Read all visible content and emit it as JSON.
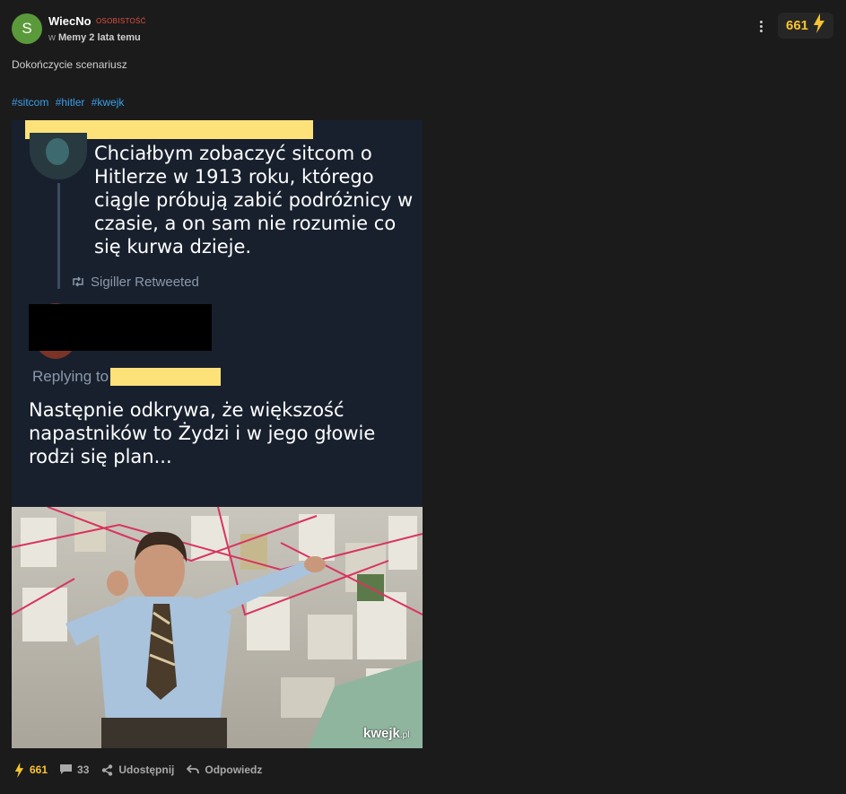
{
  "post": {
    "avatar_letter": "S",
    "username": "WiecNo",
    "badge": "OSOBISTOŚĆ",
    "meta_prefix": "w",
    "category": "Memy",
    "time": "2 lata temu",
    "score": "661",
    "description": "Dokończycie scenariusz",
    "tags": [
      "#sitcom",
      "#hitler",
      "#kwejk"
    ]
  },
  "meme": {
    "tweet1_text": "Chciałbym zobaczyć sitcom o Hitlerze w 1913 roku, którego ciągle próbują zabić podróżnicy w czasie, a on sam nie rozumie co się kurwa dzieje.",
    "retweet_text": "Sigiller Retweeted",
    "replying_text": "Replying to",
    "tweet2_text": "Następnie odkrywa, że większość napastników to Żydzi i w jego głowie rodzi się plan...",
    "watermark_main": "kwejk",
    "watermark_suffix": ".pl"
  },
  "actions": {
    "score": "661",
    "comments": "33",
    "share_label": "Udostępnij",
    "reply_label": "Odpowiedz"
  },
  "colors": {
    "background": "#1b1b1c",
    "accent_yellow": "#f7c32f",
    "tag_blue": "#3a9fe8",
    "badge_red": "#e0523f",
    "avatar_green": "#5a9a3a"
  },
  "icons": {
    "menu": "kebab-menu-icon",
    "score": "lightning-icon",
    "comments": "comment-icon",
    "share": "share-icon",
    "reply": "reply-icon",
    "retweet": "retweet-icon"
  }
}
